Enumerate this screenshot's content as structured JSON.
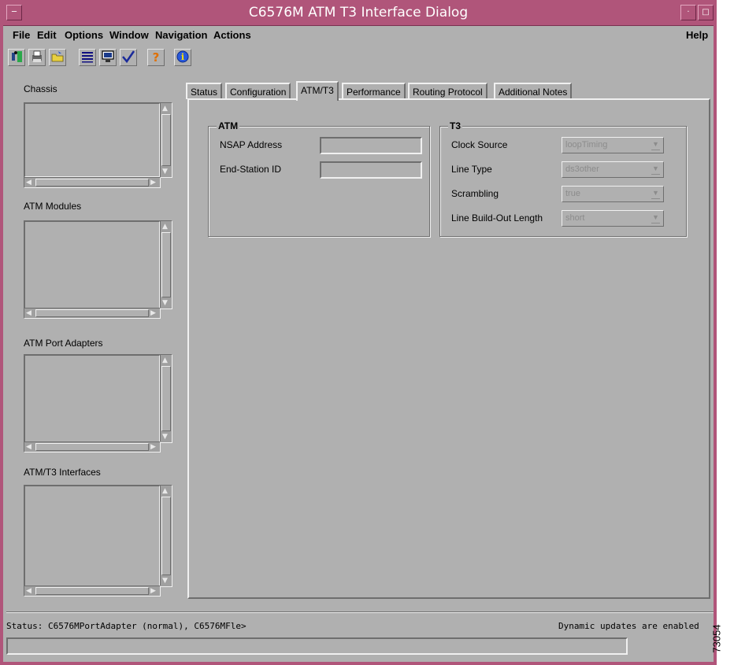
{
  "window": {
    "title": "C6576M ATM T3 Interface Dialog"
  },
  "menu": {
    "file": "File",
    "edit": "Edit",
    "options": "Options",
    "window": "Window",
    "navigation": "Navigation",
    "actions": "Actions",
    "help": "Help"
  },
  "toolbar": {
    "icons": [
      "exit-icon",
      "print-icon",
      "open-folder-icon",
      "list-icon",
      "monitor-icon",
      "check-icon",
      "help-icon",
      "info-icon"
    ],
    "help_glyph": "?",
    "info_glyph": "i"
  },
  "sidebar": {
    "chassis": "Chassis",
    "atm_modules": "ATM Modules",
    "atm_port_adapters": "ATM Port Adapters",
    "atm_t3_interfaces": "ATM/T3 Interfaces"
  },
  "tabs": [
    "Status",
    "Configuration",
    "ATM/T3",
    "Performance",
    "Routing Protocol",
    "Additional Notes"
  ],
  "active_tab": "ATM/T3",
  "atm_group": {
    "title": "ATM",
    "nsap_label": "NSAP Address",
    "nsap_value": "",
    "esi_label": "End-Station ID",
    "esi_value": ""
  },
  "t3_group": {
    "title": "T3",
    "clock_source_label": "Clock Source",
    "clock_source_value": "loopTiming",
    "line_type_label": "Line Type",
    "line_type_value": "ds3other",
    "scrambling_label": "Scrambling",
    "scrambling_value": "true",
    "lbo_label": "Line Build-Out Length",
    "lbo_value": "short"
  },
  "status": {
    "text": "Status: C6576MPortAdapter (normal), C6576MFle>",
    "updates": "Dynamic updates are enabled",
    "message": ""
  },
  "figure_id": "73054",
  "colors": {
    "title_bar": "#b0557a",
    "window_bg": "#b0b0b0"
  }
}
